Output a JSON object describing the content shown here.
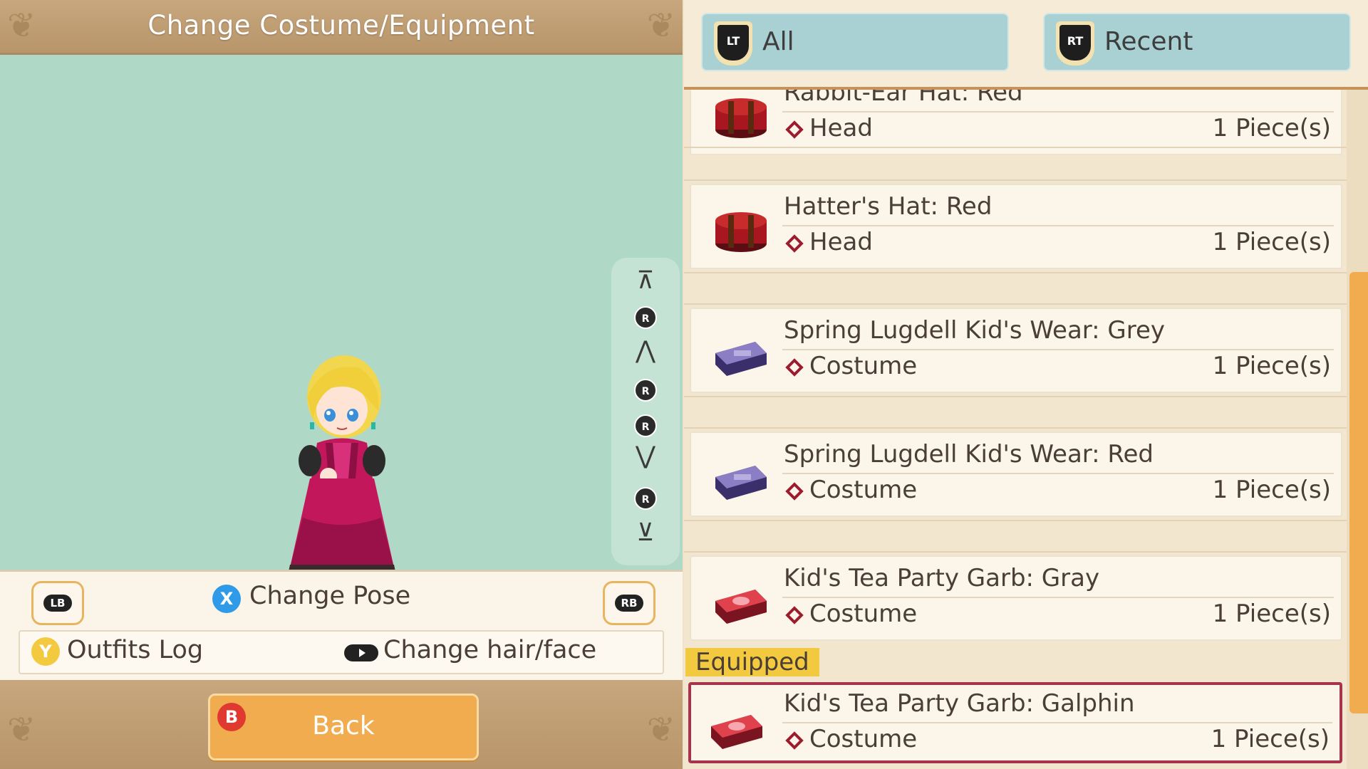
{
  "header": {
    "title": "Change Costume/Equipment"
  },
  "rotation_controls": {
    "stick_label": "R"
  },
  "controls": {
    "lb_label": "LB",
    "rb_label": "RB",
    "change_pose": {
      "button": "X",
      "label": "Change Pose",
      "color": "#2f9ae8"
    },
    "outfits_log": {
      "button": "Y",
      "label": "Outfits Log",
      "color": "#f3c93f"
    },
    "change_hair_face": {
      "label": "Change hair/face"
    },
    "back": {
      "button": "B",
      "label": "Back",
      "color": "#e0392f"
    }
  },
  "filters": [
    {
      "button": "LT",
      "label": "All"
    },
    {
      "button": "RT",
      "label": "Recent"
    }
  ],
  "items": [
    {
      "name": "Rabbit-Ear Hat: Red",
      "slot": "Head",
      "qty": "1 Piece(s)",
      "icon": "hatbox-red-icon"
    },
    {
      "name": "Hatter's Hat: Red",
      "slot": "Head",
      "qty": "1 Piece(s)",
      "icon": "hatbox-red-icon"
    },
    {
      "name": "Spring Lugdell Kid's Wear: Grey",
      "slot": "Costume",
      "qty": "1 Piece(s)",
      "icon": "suitcase-purple-icon"
    },
    {
      "name": "Spring Lugdell Kid's Wear: Red",
      "slot": "Costume",
      "qty": "1 Piece(s)",
      "icon": "suitcase-purple-icon"
    },
    {
      "name": "Kid's Tea Party Garb: Gray",
      "slot": "Costume",
      "qty": "1 Piece(s)",
      "icon": "suitcase-red-icon"
    }
  ],
  "equipped": {
    "tag": "Equipped",
    "item": {
      "name": "Kid's Tea Party Garb: Galphin",
      "slot": "Costume",
      "qty": "1 Piece(s)",
      "icon": "suitcase-red-icon"
    }
  },
  "colors": {
    "accent": "#f0ac4e",
    "viewport_bg": "#b0d8c6",
    "equipped_border": "#a8334c",
    "slot_diamond": "#9b1c2e"
  }
}
